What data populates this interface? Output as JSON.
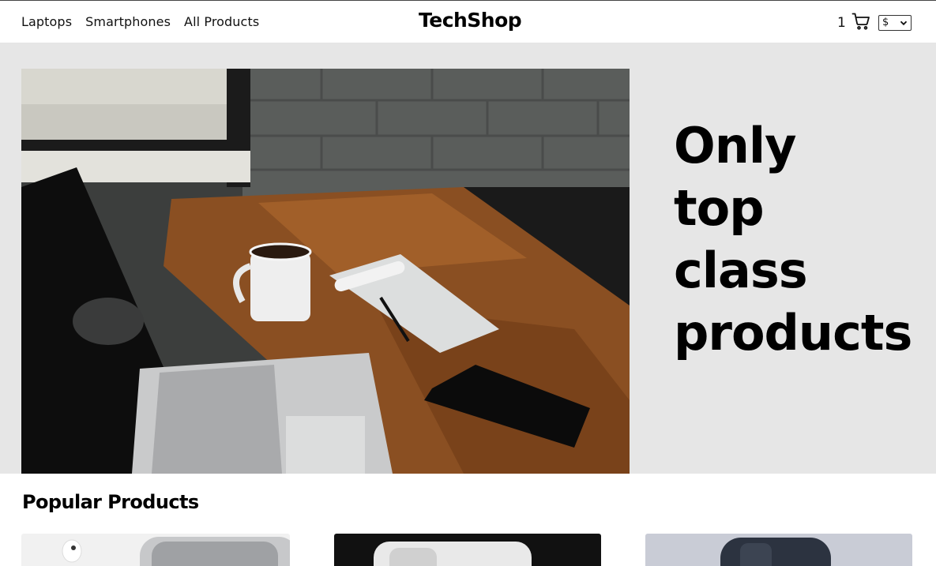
{
  "header": {
    "nav": [
      "Laptops",
      "Smartphones",
      "All Products"
    ],
    "brand": "TechShop",
    "cart_count": "1",
    "currency_selected": "$"
  },
  "hero": {
    "headline_lines": [
      "Only",
      "top",
      "class",
      "products"
    ],
    "image_icon": "workspace-photo"
  },
  "popular": {
    "title": "Popular Products",
    "cards": [
      {
        "image_icon": "earbuds-phone-photo"
      },
      {
        "image_icon": "white-phone-photo"
      },
      {
        "image_icon": "dark-phone-photo"
      }
    ]
  },
  "colors": {
    "hero_bg": "#e6e6e6",
    "text": "#000000"
  }
}
